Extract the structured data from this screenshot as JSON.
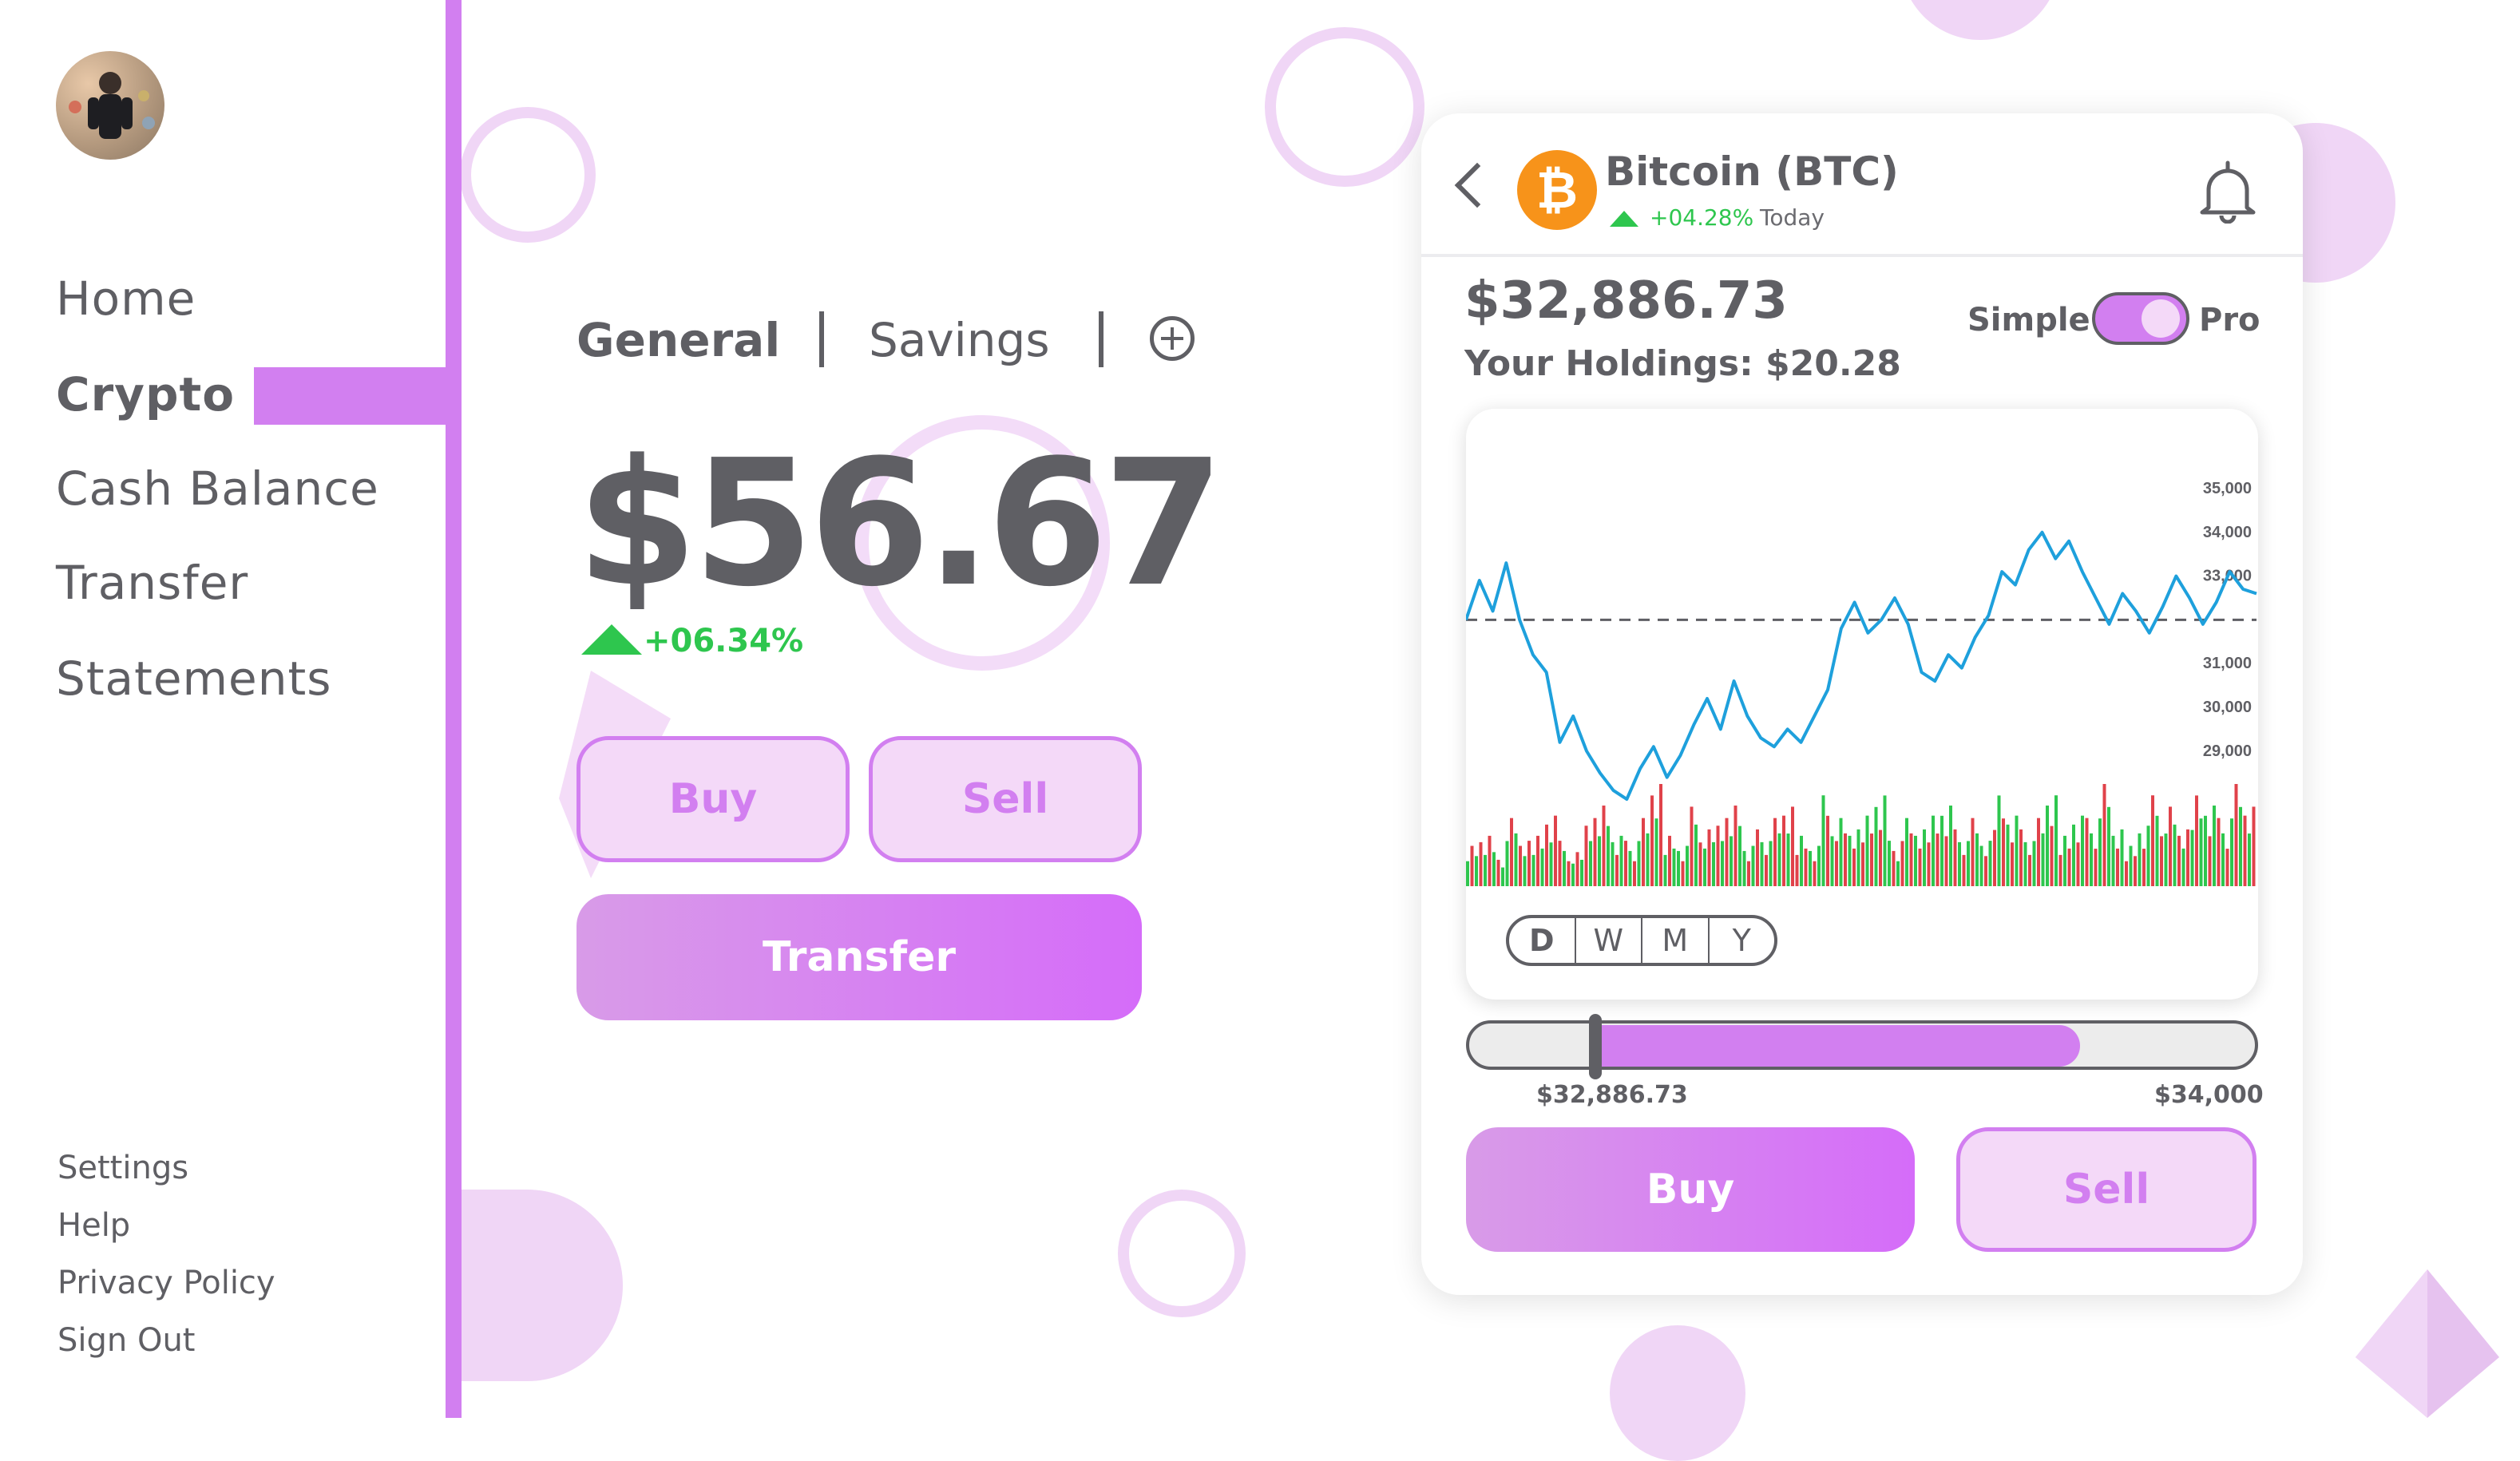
{
  "sidebar": {
    "nav": [
      {
        "label": "Home"
      },
      {
        "label": "Crypto",
        "active": true
      },
      {
        "label": "Cash Balance"
      },
      {
        "label": "Transfer"
      },
      {
        "label": "Statements"
      }
    ],
    "footer": [
      "Settings",
      "Help",
      "Privacy Policy",
      "Sign Out"
    ],
    "avatar_icon": "user-avatar"
  },
  "account": {
    "tabs": [
      {
        "label": "General",
        "active": true
      },
      {
        "label": "Savings"
      }
    ],
    "add_tab_icon": "plus-circle-icon",
    "balance": "$56.67",
    "change": "+06.34%",
    "buy_label": "Buy",
    "sell_label": "Sell",
    "transfer_label": "Transfer"
  },
  "coin": {
    "name": "Bitcoin (BTC)",
    "change": "+04.28%",
    "period": "Today",
    "price": "$32,886.73",
    "holdings": "Your Holdings: $20.28",
    "mode_simple": "Simple",
    "mode_pro": "Pro",
    "pro_enabled": true,
    "ranges": [
      "D",
      "W",
      "M",
      "Y"
    ],
    "selected_range": "D",
    "slider_min": "$32,886.73",
    "slider_max": "$34,000",
    "slider_fill": 0.78,
    "buy_label": "Buy",
    "sell_label": "Sell"
  },
  "colors": {
    "accent": "#d27ff0",
    "accent_light": "#f4d9f8",
    "text": "#5f5f64",
    "positive": "#2ec64e",
    "negative": "#e0424a",
    "line": "#1ea0dc",
    "bitcoin": "#f7931a"
  },
  "chart_data": {
    "type": "line",
    "y_ticks": [
      "35,000",
      "34,000",
      "33,000",
      "31,000",
      "30,000",
      "29,000"
    ],
    "ylim": [
      27700,
      35000
    ],
    "reference_line": 32000,
    "x": [
      0,
      1,
      2,
      3,
      4,
      5,
      6,
      7,
      8,
      9,
      10,
      11,
      12,
      13,
      14,
      15,
      16,
      17,
      18,
      19,
      20,
      21,
      22,
      23,
      24,
      25,
      26,
      27,
      28,
      29,
      30,
      31,
      32,
      33,
      34,
      35,
      36,
      37,
      38,
      39,
      40,
      41,
      42,
      43,
      44,
      45,
      46,
      47,
      48,
      49,
      50,
      51,
      52,
      53,
      54,
      55,
      56,
      57,
      58,
      59
    ],
    "values": [
      32000,
      32900,
      32200,
      33300,
      32000,
      31200,
      30800,
      29200,
      29800,
      29000,
      28500,
      28100,
      27900,
      28600,
      29100,
      28400,
      28900,
      29600,
      30200,
      29500,
      30600,
      29800,
      29300,
      29100,
      29500,
      29200,
      29800,
      30400,
      31800,
      32400,
      31700,
      32000,
      32500,
      31900,
      30800,
      30600,
      31200,
      30900,
      31600,
      32100,
      33100,
      32800,
      33600,
      34000,
      33400,
      33800,
      33100,
      32500,
      31900,
      32600,
      32200,
      31700,
      32300,
      33000,
      32500,
      31900,
      32400,
      33100,
      32700,
      32600
    ],
    "volume": [
      4,
      5,
      3,
      6,
      4,
      5,
      7,
      4,
      3,
      6,
      8,
      5,
      4,
      6,
      9,
      5,
      4,
      7,
      5,
      6,
      8,
      4,
      5,
      6,
      7,
      5,
      4,
      8,
      6,
      5,
      7,
      9,
      4,
      6,
      5,
      7,
      8,
      5,
      6,
      4,
      9,
      7,
      5,
      6,
      8,
      5,
      7,
      6,
      9,
      5,
      4,
      6,
      8,
      7,
      5,
      9,
      8,
      6,
      9,
      7
    ],
    "volume_up": [
      1,
      0,
      1,
      1,
      0,
      1,
      0,
      0,
      1,
      0,
      1,
      1,
      0,
      1,
      0,
      1,
      1,
      0,
      1,
      0,
      1,
      1,
      0,
      1,
      0,
      0,
      1,
      1,
      0,
      1,
      0,
      1,
      1,
      0,
      1,
      0,
      1,
      0,
      1,
      1,
      0,
      1,
      0,
      1,
      1,
      0,
      1,
      0,
      1,
      1,
      0,
      1,
      0,
      1,
      0,
      1,
      1,
      0,
      1,
      0
    ],
    "xlabel": "",
    "ylabel": ""
  }
}
